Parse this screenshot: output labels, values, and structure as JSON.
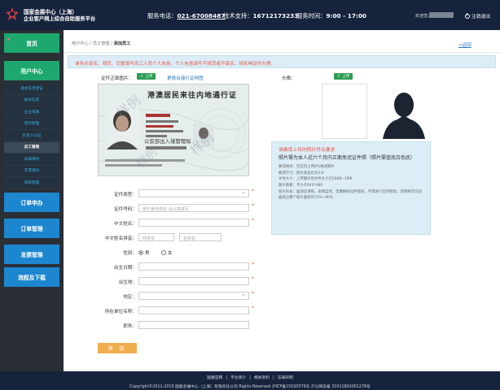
{
  "header": {
    "brand_line1": "国家会展中心（上海）",
    "brand_line2": "企业客户网上综合自助服务平台",
    "service_label": "服务电话：",
    "service_phone": "021-67008487",
    "tech_label": "技术支持：",
    "tech_phone": "16712173233",
    "hours_label": "服务时间：",
    "hours_value": "9:00 - 17:00",
    "welcome": "欢迎您，",
    "logout": "注销退出"
  },
  "sidebar": {
    "home": "首页",
    "user_center": "用户中心",
    "sub_items": [
      "基本信息登记",
      "账号信息",
      "企业资质",
      "密码管理",
      "负责人认证",
      "员工管理",
      "车辆资料",
      "开票资料",
      "资料管理"
    ],
    "active_index": 5,
    "order_apply": "订单申办",
    "order_manage": "订单管理",
    "invoice_manage": "发票管理",
    "download": "流程及下载"
  },
  "breadcrumb": {
    "home": "用户中心",
    "sep": " / ",
    "parent": "员工管理",
    "current": "添加员工"
  },
  "back_link": "<返回",
  "notice": "请务必真实、规范、完整填写员工人员个人信息。个人信息填写不规范或不真实，将影响证件办理。",
  "form": {
    "id_photo_label": "证件正面图片：",
    "upload_label": "上传",
    "switch_link": "更换台港行证样图",
    "portrait_label": "头像：",
    "card_title": "港澳居民来往内地通行证",
    "card_sub": "公安部出入境管理局",
    "watermark": "样例",
    "photo_requirements": {
      "title": "请确保上传的照片符合要求",
      "main": "照片需为本人近六个月内正面免冠证件照（照片需蓝底白色底）",
      "items": [
        "要求格式：仅支持上传JPG格式图片",
        "要求尺寸：照片宽高比为3:4",
        "文件大小：上传图片的文件大小在50KB~1MB",
        "图片像素：不小于640*480",
        "照片形式：面部应清晰，表情自然，无模糊的拉伸变形，不得进行任何修饰，须清晰可识别",
        "面部占整个照片面积的70%~80%"
      ]
    },
    "fields": {
      "doc_type": "证件类型：",
      "doc_no": "证件号码：",
      "doc_no_placeholder": "用于身份校验 请认真填写",
      "cn_name": "中文姓名：",
      "pinyin_name": "中文姓名拼音：",
      "surname_placeholder": "姓拼音",
      "given_placeholder": "名拼音",
      "gender": "性别：",
      "male": "男",
      "female": "女",
      "birth_date": "出生日期：",
      "birth_place": "出生地：",
      "region": "地区：",
      "org": "所在单位名称：",
      "position": "职务："
    },
    "add_button": "添 加"
  },
  "footer": {
    "links": [
      "国展官网",
      "平台简介",
      "相关资料",
      "法律声明"
    ],
    "separator": "|",
    "copyright": "Copyright©2011-2019 国家会展中心（上海）有限责任公司 Rights Reserved    沪ICP备15020579号    沪公网安备 31011802001278号"
  }
}
